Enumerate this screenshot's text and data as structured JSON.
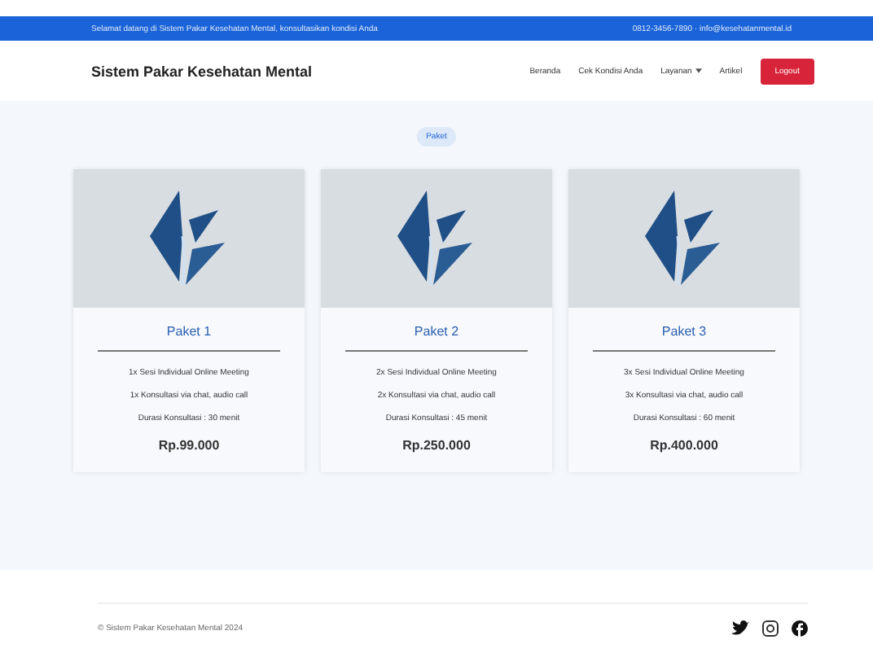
{
  "topbar": {
    "message": "Selamat datang di Sistem Pakar Kesehatan Mental, konsultasikan kondisi Anda",
    "contact": "0812-3456-7890 · info@kesehatanmental.id"
  },
  "navbar": {
    "brand": "Sistem Pakar Kesehatan Mental",
    "links": [
      {
        "label": "Beranda",
        "dropdown": false
      },
      {
        "label": "Cek Kondisi Anda",
        "dropdown": false
      },
      {
        "label": "Layanan",
        "dropdown": true
      },
      {
        "label": "Artikel",
        "dropdown": false
      }
    ],
    "button": "Logout"
  },
  "section": {
    "badge": "Paket"
  },
  "packages": [
    {
      "title": "Paket 1",
      "features": [
        "1x Sesi Individual Online Meeting",
        "1x Konsultasi via chat, audio call",
        "Durasi Konsultasi : 30 menit"
      ],
      "price": "Rp.99.000"
    },
    {
      "title": "Paket 2",
      "features": [
        "2x Sesi Individual Online Meeting",
        "2x Konsultasi via chat, audio call",
        "Durasi Konsultasi : 45 menit"
      ],
      "price": "Rp.250.000"
    },
    {
      "title": "Paket 3",
      "features": [
        "3x Sesi Individual Online Meeting",
        "3x Konsultasi via chat, audio call",
        "Durasi Konsultasi : 60 menit"
      ],
      "price": "Rp.400.000"
    }
  ],
  "footer": {
    "copyright": "© Sistem Pakar Kesehatan Mental 2024"
  }
}
